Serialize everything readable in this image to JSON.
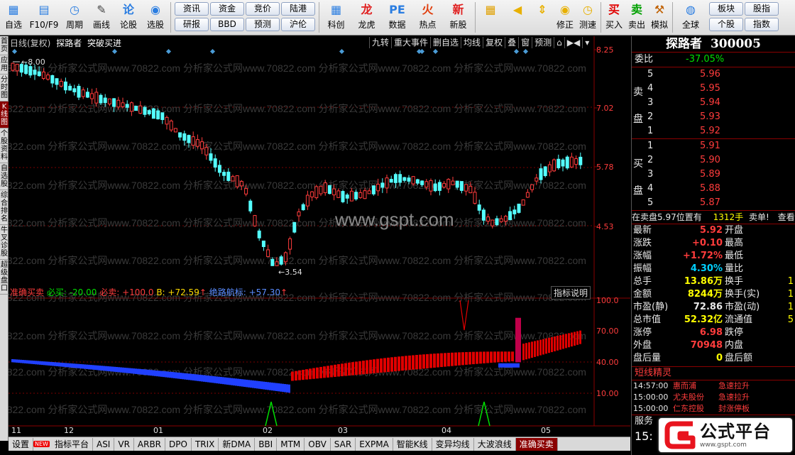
{
  "toolbar": {
    "main": [
      {
        "label": "自选",
        "icon": "star-grid-icon"
      },
      {
        "label": "F10/F9",
        "icon": "f10-icon"
      },
      {
        "label": "周期",
        "icon": "clock-icon"
      },
      {
        "label": "画线",
        "icon": "pen-icon"
      },
      {
        "label": "论股",
        "icon": "lun-icon"
      },
      {
        "label": "选股",
        "icon": "filter-icon"
      }
    ],
    "grid_buttons": [
      [
        "资讯",
        "研报"
      ],
      [
        "资金",
        "BBD"
      ],
      [
        "竞价",
        "预测"
      ],
      [
        "陆港",
        "沪伦"
      ]
    ],
    "tools": [
      {
        "label": "科创",
        "icon": "chart-icon"
      },
      {
        "label": "龙虎",
        "icon": "dragon-icon"
      },
      {
        "label": "数据",
        "icon": "pe-icon"
      },
      {
        "label": "热点",
        "icon": "fire-icon"
      },
      {
        "label": "新股",
        "icon": "newstock-icon"
      }
    ],
    "nav": [
      {
        "label": "",
        "icon": "color-grid-icon"
      },
      {
        "label": "",
        "icon": "back-arrow-icon"
      },
      {
        "label": "",
        "icon": "updown-arrow-icon"
      },
      {
        "label": "修正",
        "icon": "fix-icon"
      },
      {
        "label": "测速",
        "icon": "speed-icon"
      }
    ],
    "trade": [
      {
        "label": "买入",
        "icon": "buy-icon",
        "glyph": "买"
      },
      {
        "label": "卖出",
        "icon": "sell-icon",
        "glyph": "卖"
      },
      {
        "label": "模拟",
        "icon": "hammer-icon",
        "glyph": "⚒"
      }
    ],
    "globe_label": "全球",
    "right_grid": [
      [
        "板块",
        "个股"
      ],
      [
        "股指",
        "指数"
      ]
    ]
  },
  "left_tabs": [
    "首页",
    "应用",
    "分时图",
    "K线图",
    "个股资料",
    "自选股",
    "综合排名",
    "牛叉诊股",
    "超级盘口"
  ],
  "left_tab_active": 3,
  "chart_header": {
    "line1": "日线(复权)",
    "line2": "探路者",
    "line3": "突破买进"
  },
  "k_toolbar": [
    "九转",
    "重大事件",
    "删自选",
    "均线",
    "复权",
    "叠",
    "窗",
    "预测",
    "⌂",
    "▶◀",
    "▾"
  ],
  "price_labels": [
    "8.25",
    "7.02",
    "5.78",
    "4.53"
  ],
  "ind_labels": [
    "100.0",
    "70.00",
    "40.00",
    "10.00"
  ],
  "annotations": {
    "high": "8.00",
    "low": "3.54"
  },
  "indicator": {
    "name": "准确买卖",
    "b1": "必买: -20.00",
    "b2": "必卖: +100.0",
    "b3": "B: +72.59",
    "b4": "绝路航标: +57.30",
    "btn": "指标说明"
  },
  "dates": [
    "11",
    "12",
    "01",
    "02",
    "03",
    "04",
    "05"
  ],
  "bottom_tabs": [
    "设置",
    "指标平台",
    "ASI",
    "VR",
    "ARBR",
    "DPO",
    "TRIX",
    "新DMA",
    "BBI",
    "MTM",
    "OBV",
    "SAR",
    "EXPMA",
    "智能K线",
    "变异均线",
    "大波浪线",
    "准确买卖"
  ],
  "bottom_tab_active": 16,
  "new_tag": "NEW",
  "watermark": "www.gspt.com",
  "bg_watermark": "0822.com  分析家公式网www.70822.com  分析家公式网www.70822.com  分析家公式网www.70822.com  分析家公式网www.70822.com",
  "stock": {
    "name": "探路者",
    "code": "300005"
  },
  "weibi": {
    "label": "委比",
    "value": "-37.05%"
  },
  "sell_label": [
    "卖",
    "盘"
  ],
  "buy_label": [
    "买",
    "盘"
  ],
  "asks": [
    {
      "n": "5",
      "p": "5.96"
    },
    {
      "n": "4",
      "p": "5.95"
    },
    {
      "n": "3",
      "p": "5.94"
    },
    {
      "n": "2",
      "p": "5.93"
    },
    {
      "n": "1",
      "p": "5.92"
    }
  ],
  "bids": [
    {
      "n": "1",
      "p": "5.91"
    },
    {
      "n": "2",
      "p": "5.90"
    },
    {
      "n": "3",
      "p": "5.89"
    },
    {
      "n": "4",
      "p": "5.88"
    },
    {
      "n": "5",
      "p": "5.87"
    }
  ],
  "sell_bar": {
    "text": "在卖盘5.97位置有",
    "qty": "1312手",
    "tail": "卖单!",
    "extra": "查看"
  },
  "stats": [
    {
      "l": "最新",
      "v": "5.92",
      "vc": "red",
      "l2": "开盘",
      "v2": ""
    },
    {
      "l": "涨跌",
      "v": "+0.10",
      "vc": "red",
      "l2": "最高",
      "v2": ""
    },
    {
      "l": "涨幅",
      "v": "+1.72%",
      "vc": "red",
      "l2": "最低",
      "v2": ""
    },
    {
      "l": "振幅",
      "v": "4.30%",
      "vc": "cyan",
      "l2": "量比",
      "v2": ""
    },
    {
      "l": "总手",
      "v": "13.86万",
      "vc": "yel",
      "l2": "换手",
      "v2": "1"
    },
    {
      "l": "金额",
      "v": "8244万",
      "vc": "yel",
      "l2": "换手(实)",
      "v2": "1"
    },
    {
      "l": "市盈(静)",
      "v": "72.86",
      "vc": "wht",
      "l2": "市盈(动)",
      "v2": "1"
    },
    {
      "l": "总市值",
      "v": "52.32亿",
      "vc": "yel",
      "l2": "流通值",
      "v2": "5"
    },
    {
      "l": "涨停",
      "v": "6.98",
      "vc": "red",
      "l2": "跌停",
      "v2": ""
    },
    {
      "l": "外盘",
      "v": "70948",
      "vc": "red",
      "l2": "内盘",
      "v2": ""
    },
    {
      "l": "盘后量",
      "v": "0",
      "vc": "yel",
      "l2": "盘后额",
      "v2": ""
    }
  ],
  "news": {
    "title": "短线精灵",
    "items": [
      {
        "t": "14:57:00",
        "n": "惠而浦",
        "e": "急速拉升"
      },
      {
        "t": "15:00:00",
        "n": "尤夫股份",
        "e": "急速拉升"
      },
      {
        "t": "15:00:00",
        "n": "仁东控股",
        "e": "封涨停板"
      }
    ]
  },
  "footer": {
    "a": "服务",
    "b": "15:"
  },
  "logo": {
    "text": "公式平台",
    "sub": "www.gspt.com"
  },
  "colors": {
    "up": "#ff3c3c",
    "down": "#54ffff",
    "ma": "#ffffff",
    "panel_border": "#8a0000",
    "ind_red": "#e00000",
    "ind_blue": "#2040ff",
    "ind_green": "#00e000"
  }
}
